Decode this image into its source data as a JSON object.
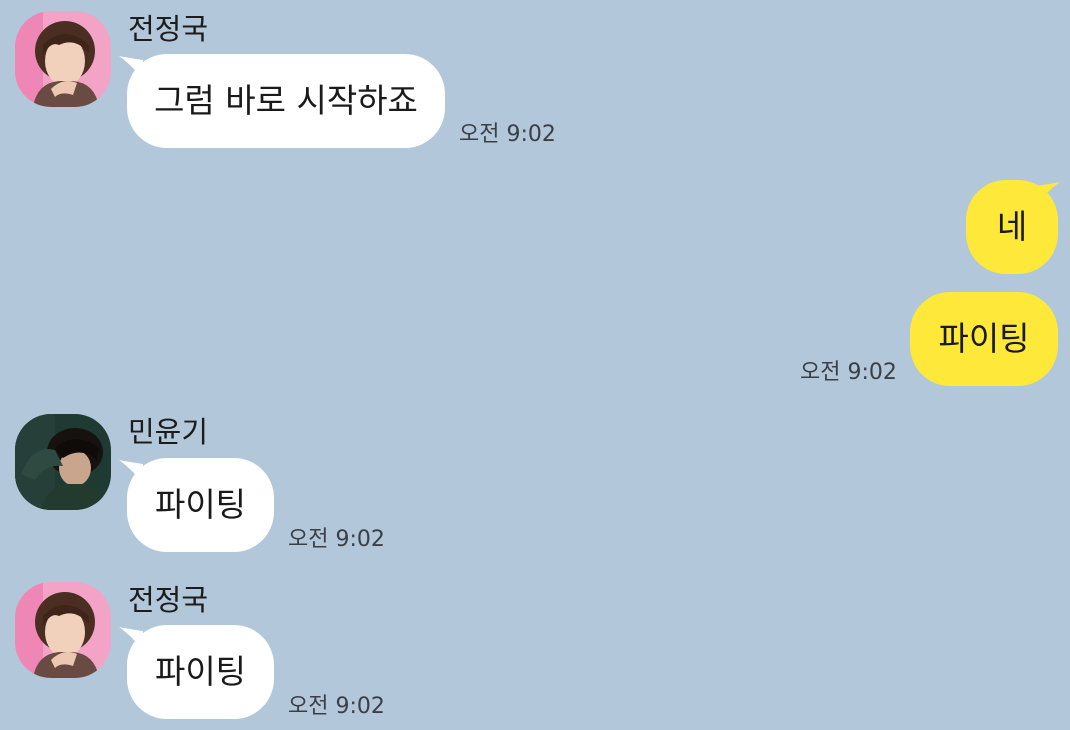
{
  "messages": [
    {
      "sender": "전정국",
      "text": "그럼 바로 시작하죠",
      "time": "오전 9:02",
      "avatar_icon": "jungkook-profile-photo"
    },
    {
      "text": "네",
      "outgoing": true
    },
    {
      "text": "파이팅",
      "time": "오전 9:02",
      "outgoing": true
    },
    {
      "sender": "민윤기",
      "text": "파이팅",
      "time": "오전 9:02",
      "avatar_icon": "yoongi-profile-photo"
    },
    {
      "sender": "전정국",
      "text": "파이팅",
      "time": "오전 9:02",
      "avatar_icon": "jungkook-profile-photo"
    }
  ],
  "colors": {
    "background": "#b2c7da",
    "incoming_bubble": "#ffffff",
    "outgoing_bubble": "#fee93a"
  }
}
